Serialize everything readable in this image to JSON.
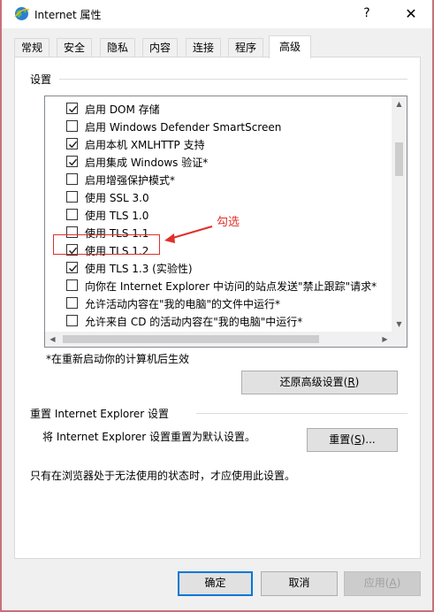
{
  "window": {
    "title": "Internet 属性",
    "help": "?",
    "close": "✕"
  },
  "tabs": [
    "常规",
    "安全",
    "隐私",
    "内容",
    "连接",
    "程序",
    "高级"
  ],
  "active_tab": "高级",
  "settings_group_label": "设置",
  "settings_items": [
    {
      "label": "启用 DOM 存储",
      "checked": true
    },
    {
      "label": "启用 Windows Defender SmartScreen",
      "checked": false
    },
    {
      "label": "启用本机 XMLHTTP 支持",
      "checked": true
    },
    {
      "label": "启用集成 Windows 验证*",
      "checked": true
    },
    {
      "label": "启用增强保护模式*",
      "checked": false
    },
    {
      "label": "使用 SSL 3.0",
      "checked": false
    },
    {
      "label": "使用 TLS 1.0",
      "checked": false
    },
    {
      "label": "使用 TLS 1.1",
      "checked": false
    },
    {
      "label": "使用 TLS 1.2",
      "checked": true
    },
    {
      "label": "使用 TLS 1.3 (实验性)",
      "checked": true
    },
    {
      "label": "向你在 Internet Explorer 中访问的站点发送\"禁止跟踪\"请求*",
      "checked": false
    },
    {
      "label": "允许活动内容在\"我的电脑\"的文件中运行*",
      "checked": false
    },
    {
      "label": "允许来自 CD 的活动内容在\"我的电脑\"中运行*",
      "checked": false
    }
  ],
  "annotation": {
    "text": "勾选",
    "color": "#e0302a"
  },
  "restart_note": "*在重新启动你的计算机后生效",
  "restore_button": {
    "prefix": "还原高级设置(",
    "key": "R",
    "suffix": ")"
  },
  "reset_group_label": "重置 Internet Explorer 设置",
  "reset_description": "将 Internet Explorer 设置重置为默认设置。",
  "reset_button": {
    "prefix": "重置(",
    "key": "S",
    "suffix": ")..."
  },
  "reset_note": "只有在浏览器处于无法使用的状态时，才应使用此设置。",
  "footer": {
    "ok": "确定",
    "cancel": "取消",
    "apply": {
      "prefix": "应用(",
      "key": "A",
      "suffix": ")"
    }
  },
  "colors": {
    "accent": "#0078d7",
    "annotation": "#e0302a",
    "background": "#c8707a"
  }
}
